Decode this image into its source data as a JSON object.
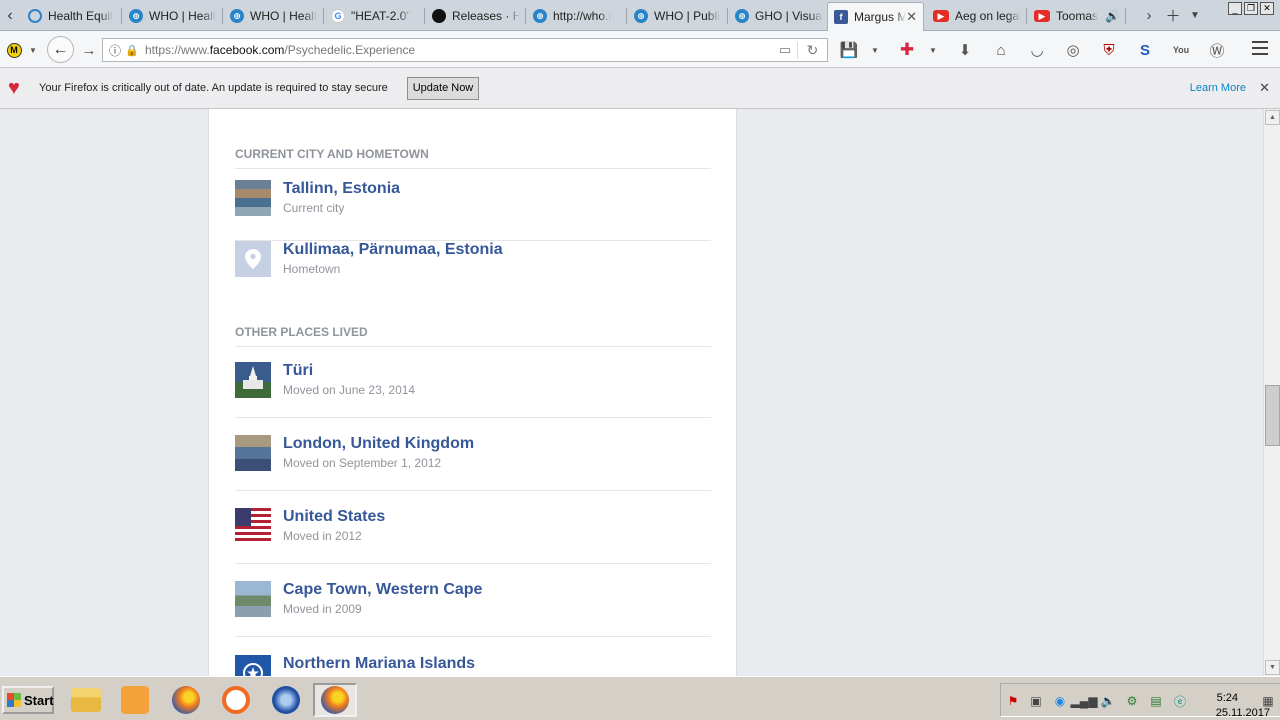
{
  "browser": {
    "tabs": [
      {
        "title": "Health Equit",
        "favicon": "health-equity-favicon"
      },
      {
        "title": "WHO | Healt",
        "favicon": "who-favicon"
      },
      {
        "title": "WHO | Healt",
        "favicon": "who-favicon"
      },
      {
        "title": "\"HEAT-2.0\"",
        "favicon": "google-favicon"
      },
      {
        "title": "Releases · H",
        "favicon": "github-favicon"
      },
      {
        "title": "http://who.i",
        "favicon": "who-favicon"
      },
      {
        "title": "WHO | Publi",
        "favicon": "who-favicon"
      },
      {
        "title": "GHO | Visual",
        "favicon": "who-favicon"
      },
      {
        "title": "Margus M",
        "favicon": "facebook-favicon",
        "active": true
      },
      {
        "title": "Aeg on legal",
        "favicon": "youtube-favicon"
      },
      {
        "title": "Toomas",
        "favicon": "youtube-favicon",
        "audio": true
      }
    ],
    "url_prefix": "https://www.",
    "url_domain": "facebook.com",
    "url_path": "/Psychedelic.Experience"
  },
  "notification": {
    "message": "Your Firefox is critically out of date. An update is required to stay secure",
    "button": "Update Now",
    "link": "Learn More"
  },
  "about": {
    "current_section": {
      "heading": "CURRENT CITY AND HOMETOWN",
      "items": [
        {
          "name": "Tallinn, Estonia",
          "sub": "Current city",
          "thumb": "city-photo"
        },
        {
          "name": "Kullimaa, Pärnumaa, Estonia",
          "sub": "Hometown",
          "thumb": "map-pin-icon"
        }
      ]
    },
    "other_section": {
      "heading": "OTHER PLACES LIVED",
      "items": [
        {
          "name": "Türi",
          "sub": "Moved on June 23, 2014",
          "thumb": "church-photo"
        },
        {
          "name": "London, United Kingdom",
          "sub": "Moved on September 1, 2012",
          "thumb": "london-photo"
        },
        {
          "name": "United States",
          "sub": "Moved in 2012",
          "thumb": "us-flag"
        },
        {
          "name": "Cape Town, Western Cape",
          "sub": "Moved in 2009",
          "thumb": "cape-town-photo"
        },
        {
          "name": "Northern Mariana Islands",
          "sub": "",
          "thumb": "nmi-flag"
        }
      ]
    }
  },
  "taskbar": {
    "start_label": "Start",
    "time": "5:24",
    "date": "25.11.2017"
  },
  "colors": {
    "link": "#365899",
    "muted": "#90949c",
    "page_bg": "#e9ebee"
  }
}
